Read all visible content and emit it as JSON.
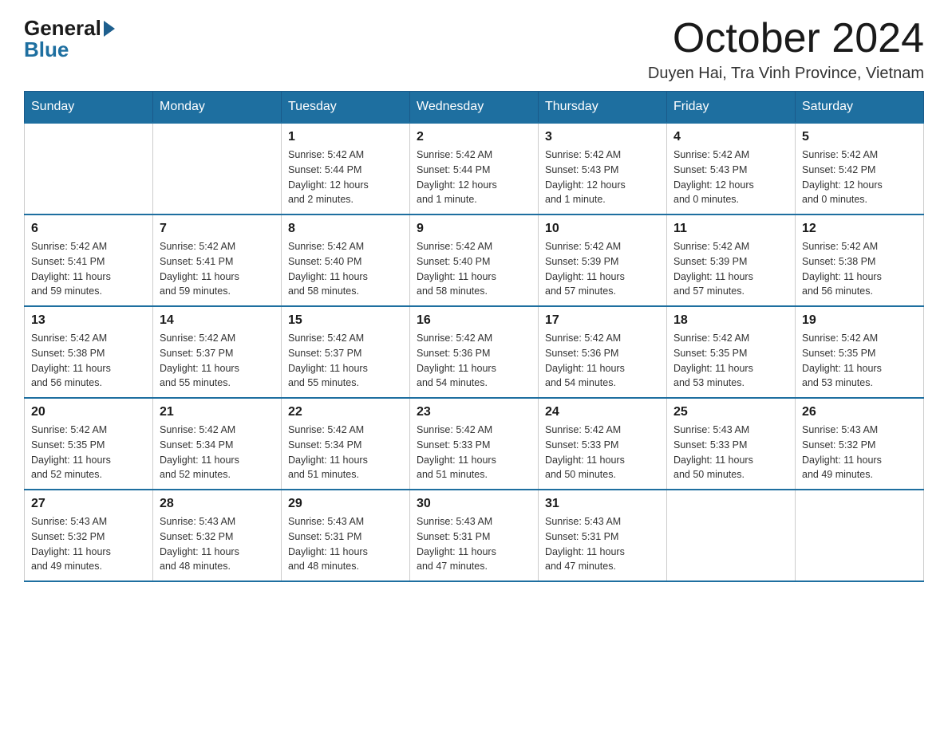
{
  "header": {
    "logo_general": "General",
    "logo_blue": "Blue",
    "title": "October 2024",
    "location": "Duyen Hai, Tra Vinh Province, Vietnam"
  },
  "days_of_week": [
    "Sunday",
    "Monday",
    "Tuesday",
    "Wednesday",
    "Thursday",
    "Friday",
    "Saturday"
  ],
  "weeks": [
    [
      {
        "day": "",
        "info": ""
      },
      {
        "day": "",
        "info": ""
      },
      {
        "day": "1",
        "info": "Sunrise: 5:42 AM\nSunset: 5:44 PM\nDaylight: 12 hours\nand 2 minutes."
      },
      {
        "day": "2",
        "info": "Sunrise: 5:42 AM\nSunset: 5:44 PM\nDaylight: 12 hours\nand 1 minute."
      },
      {
        "day": "3",
        "info": "Sunrise: 5:42 AM\nSunset: 5:43 PM\nDaylight: 12 hours\nand 1 minute."
      },
      {
        "day": "4",
        "info": "Sunrise: 5:42 AM\nSunset: 5:43 PM\nDaylight: 12 hours\nand 0 minutes."
      },
      {
        "day": "5",
        "info": "Sunrise: 5:42 AM\nSunset: 5:42 PM\nDaylight: 12 hours\nand 0 minutes."
      }
    ],
    [
      {
        "day": "6",
        "info": "Sunrise: 5:42 AM\nSunset: 5:41 PM\nDaylight: 11 hours\nand 59 minutes."
      },
      {
        "day": "7",
        "info": "Sunrise: 5:42 AM\nSunset: 5:41 PM\nDaylight: 11 hours\nand 59 minutes."
      },
      {
        "day": "8",
        "info": "Sunrise: 5:42 AM\nSunset: 5:40 PM\nDaylight: 11 hours\nand 58 minutes."
      },
      {
        "day": "9",
        "info": "Sunrise: 5:42 AM\nSunset: 5:40 PM\nDaylight: 11 hours\nand 58 minutes."
      },
      {
        "day": "10",
        "info": "Sunrise: 5:42 AM\nSunset: 5:39 PM\nDaylight: 11 hours\nand 57 minutes."
      },
      {
        "day": "11",
        "info": "Sunrise: 5:42 AM\nSunset: 5:39 PM\nDaylight: 11 hours\nand 57 minutes."
      },
      {
        "day": "12",
        "info": "Sunrise: 5:42 AM\nSunset: 5:38 PM\nDaylight: 11 hours\nand 56 minutes."
      }
    ],
    [
      {
        "day": "13",
        "info": "Sunrise: 5:42 AM\nSunset: 5:38 PM\nDaylight: 11 hours\nand 56 minutes."
      },
      {
        "day": "14",
        "info": "Sunrise: 5:42 AM\nSunset: 5:37 PM\nDaylight: 11 hours\nand 55 minutes."
      },
      {
        "day": "15",
        "info": "Sunrise: 5:42 AM\nSunset: 5:37 PM\nDaylight: 11 hours\nand 55 minutes."
      },
      {
        "day": "16",
        "info": "Sunrise: 5:42 AM\nSunset: 5:36 PM\nDaylight: 11 hours\nand 54 minutes."
      },
      {
        "day": "17",
        "info": "Sunrise: 5:42 AM\nSunset: 5:36 PM\nDaylight: 11 hours\nand 54 minutes."
      },
      {
        "day": "18",
        "info": "Sunrise: 5:42 AM\nSunset: 5:35 PM\nDaylight: 11 hours\nand 53 minutes."
      },
      {
        "day": "19",
        "info": "Sunrise: 5:42 AM\nSunset: 5:35 PM\nDaylight: 11 hours\nand 53 minutes."
      }
    ],
    [
      {
        "day": "20",
        "info": "Sunrise: 5:42 AM\nSunset: 5:35 PM\nDaylight: 11 hours\nand 52 minutes."
      },
      {
        "day": "21",
        "info": "Sunrise: 5:42 AM\nSunset: 5:34 PM\nDaylight: 11 hours\nand 52 minutes."
      },
      {
        "day": "22",
        "info": "Sunrise: 5:42 AM\nSunset: 5:34 PM\nDaylight: 11 hours\nand 51 minutes."
      },
      {
        "day": "23",
        "info": "Sunrise: 5:42 AM\nSunset: 5:33 PM\nDaylight: 11 hours\nand 51 minutes."
      },
      {
        "day": "24",
        "info": "Sunrise: 5:42 AM\nSunset: 5:33 PM\nDaylight: 11 hours\nand 50 minutes."
      },
      {
        "day": "25",
        "info": "Sunrise: 5:43 AM\nSunset: 5:33 PM\nDaylight: 11 hours\nand 50 minutes."
      },
      {
        "day": "26",
        "info": "Sunrise: 5:43 AM\nSunset: 5:32 PM\nDaylight: 11 hours\nand 49 minutes."
      }
    ],
    [
      {
        "day": "27",
        "info": "Sunrise: 5:43 AM\nSunset: 5:32 PM\nDaylight: 11 hours\nand 49 minutes."
      },
      {
        "day": "28",
        "info": "Sunrise: 5:43 AM\nSunset: 5:32 PM\nDaylight: 11 hours\nand 48 minutes."
      },
      {
        "day": "29",
        "info": "Sunrise: 5:43 AM\nSunset: 5:31 PM\nDaylight: 11 hours\nand 48 minutes."
      },
      {
        "day": "30",
        "info": "Sunrise: 5:43 AM\nSunset: 5:31 PM\nDaylight: 11 hours\nand 47 minutes."
      },
      {
        "day": "31",
        "info": "Sunrise: 5:43 AM\nSunset: 5:31 PM\nDaylight: 11 hours\nand 47 minutes."
      },
      {
        "day": "",
        "info": ""
      },
      {
        "day": "",
        "info": ""
      }
    ]
  ]
}
